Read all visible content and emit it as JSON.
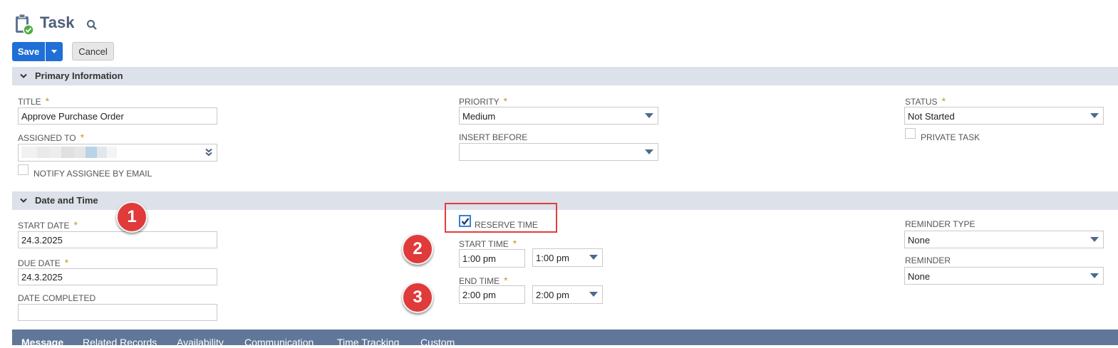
{
  "header": {
    "title": "Task"
  },
  "toolbar": {
    "save_label": "Save",
    "cancel_label": "Cancel"
  },
  "sections": {
    "primary": "Primary Information",
    "datetime": "Date and Time"
  },
  "primary": {
    "title_label": "TITLE",
    "title_value": "Approve Purchase Order",
    "assigned_label": "ASSIGNED TO",
    "notify_label": "NOTIFY ASSIGNEE BY EMAIL",
    "priority_label": "PRIORITY",
    "priority_value": "Medium",
    "insert_before_label": "INSERT BEFORE",
    "insert_before_value": "",
    "status_label": "STATUS",
    "status_value": "Not Started",
    "private_label": "PRIVATE TASK"
  },
  "datetime": {
    "start_date_label": "START DATE",
    "start_date_value": "24.3.2025",
    "due_date_label": "DUE DATE",
    "due_date_value": "24.3.2025",
    "date_completed_label": "DATE COMPLETED",
    "date_completed_value": "",
    "reserve_time_label": "RESERVE TIME",
    "reserve_time_checked": true,
    "start_time_label": "START TIME",
    "start_time_value": "1:00 pm",
    "start_time_select": "1:00 pm",
    "end_time_label": "END TIME",
    "end_time_value": "2:00 pm",
    "end_time_select": "2:00 pm",
    "reminder_type_label": "REMINDER TYPE",
    "reminder_type_value": "None",
    "reminder_label": "REMINDER",
    "reminder_value": "None"
  },
  "annotations": {
    "badge1": "1",
    "badge2": "2",
    "badge3": "3"
  },
  "tabs": [
    {
      "label": "Message"
    },
    {
      "label": "Related Records"
    },
    {
      "label": "Availability"
    },
    {
      "label": "Communication"
    },
    {
      "label": "Time Tracking"
    },
    {
      "label": "Custom"
    }
  ],
  "colors": {
    "accent": "#1f6fd6",
    "section_bg": "#dde1e9",
    "tab_bar": "#607799",
    "required": "#c49a1f",
    "annotation": "#e03a3a"
  }
}
